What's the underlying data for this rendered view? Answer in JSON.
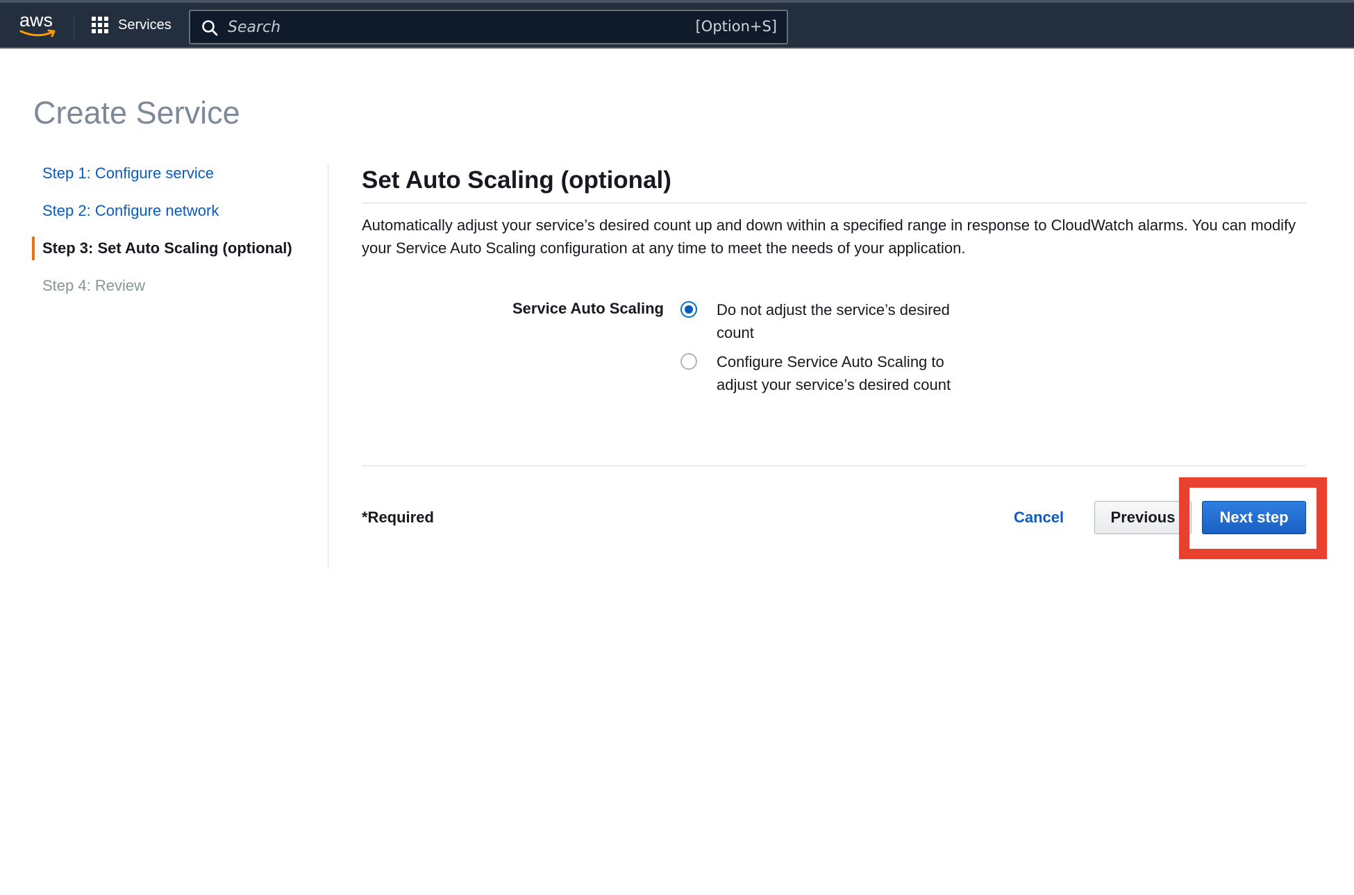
{
  "topnav": {
    "logo_text": "aws",
    "services_label": "Services",
    "search_placeholder": "Search",
    "search_shortcut": "[Option+S]"
  },
  "page": {
    "title": "Create Service"
  },
  "steps": [
    {
      "label": "Step 1: Configure service",
      "state": "link"
    },
    {
      "label": "Step 2: Configure network",
      "state": "link"
    },
    {
      "label": "Step 3: Set Auto Scaling (optional)",
      "state": "active"
    },
    {
      "label": "Step 4: Review",
      "state": "disabled"
    }
  ],
  "main": {
    "section_title": "Set Auto Scaling (optional)",
    "description": "Automatically adjust your service’s desired count up and down within a specified range in response to CloudWatch alarms. You can modify your Service Auto Scaling configuration at any time to meet the needs of your application.",
    "field_label": "Service Auto Scaling",
    "options": [
      {
        "label": "Do not adjust the service’s desired count",
        "checked": true
      },
      {
        "label": "Configure Service Auto Scaling to adjust your service’s desired count",
        "checked": false
      }
    ]
  },
  "footer": {
    "required_note": "*Required",
    "cancel_label": "Cancel",
    "previous_label": "Previous",
    "next_label": "Next step"
  },
  "colors": {
    "nav_bg": "#232f3e",
    "link": "#0a5bbf",
    "active_step_marker": "#ec7211",
    "primary_button": "#1a5fc4",
    "highlight": "#e8412f"
  }
}
